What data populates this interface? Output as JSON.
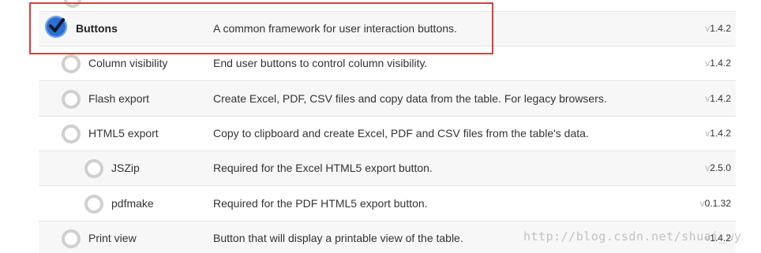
{
  "rows": [
    {
      "name": "Buttons",
      "description": "A common framework for user interaction buttons.",
      "version_prefix": "v",
      "version": "1.4.2",
      "selected": true
    },
    {
      "name": "Column visibility",
      "description": "End user buttons to control column visibility.",
      "version_prefix": "v",
      "version": "1.4.2",
      "selected": false
    },
    {
      "name": "Flash export",
      "description": "Create Excel, PDF, CSV files and copy data from the table. For legacy browsers.",
      "version_prefix": "v",
      "version": "1.4.2",
      "selected": false
    },
    {
      "name": "HTML5 export",
      "description": "Copy to clipboard and create Excel, PDF and CSV files from the table's data.",
      "version_prefix": "v",
      "version": "1.4.2",
      "selected": false
    },
    {
      "name": "JSZip",
      "description": "Required for the Excel HTML5 export button.",
      "version_prefix": "v",
      "version": "2.5.0",
      "selected": false
    },
    {
      "name": "pdfmake",
      "description": "Required for the PDF HTML5 export button.",
      "version_prefix": "v",
      "version": "0.1.32",
      "selected": false
    },
    {
      "name": "Print view",
      "description": "Button that will display a printable view of the table.",
      "version_prefix": "v",
      "version": "1.4.2",
      "selected": false
    }
  ],
  "watermark": "http://blog.csdn.net/shuai_wy",
  "colors": {
    "highlight": "#e0393e",
    "check": "#2f6fcf",
    "radio_border": "#cfcfcf"
  }
}
